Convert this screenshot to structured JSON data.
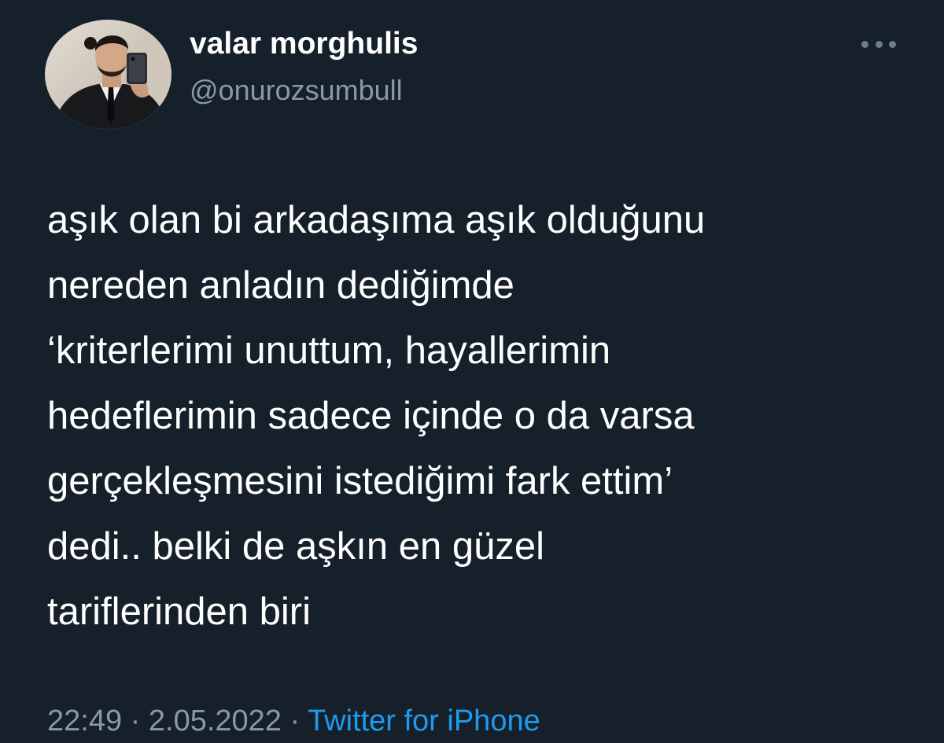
{
  "author": {
    "display_name": "valar morghulis",
    "handle": "@onurozsumbull"
  },
  "tweet": {
    "lines": [
      "aşık olan bi arkadaşıma aşık olduğunu",
      "nereden anladın dediğimde",
      "‘kriterlerimi unuttum, hayallerimin",
      "hedeflerimin sadece içinde o da varsa",
      "gerçekleşmesini istediğimi fark ettim’",
      "dedi.. belki de aşkın en güzel",
      "tariflerinden biri"
    ]
  },
  "meta": {
    "time": "22:49",
    "separator": " · ",
    "date": "2.05.2022",
    "source": "Twitter for iPhone"
  },
  "colors": {
    "background": "#15202b",
    "text": "#ffffff",
    "secondary": "#8b98a5",
    "link": "#1d9bf0"
  },
  "icons": {
    "more": "more-horizontal-icon"
  }
}
